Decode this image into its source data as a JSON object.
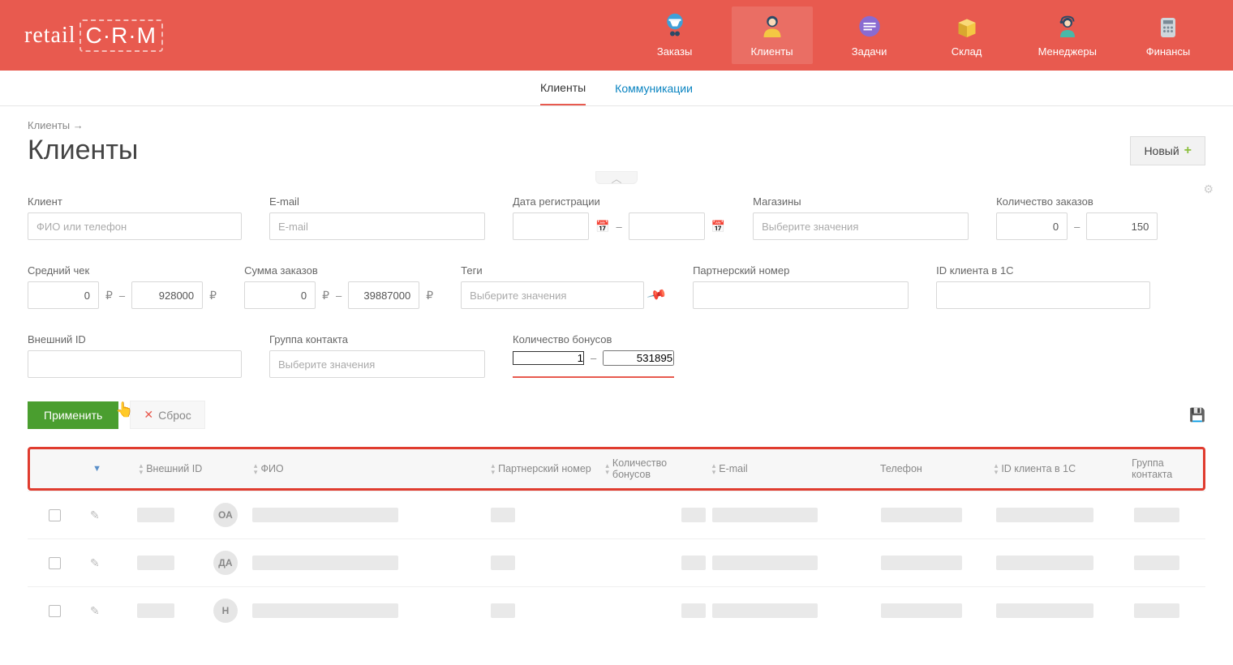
{
  "nav": {
    "logo": "retailCRM",
    "items": [
      {
        "label": "Заказы"
      },
      {
        "label": "Клиенты"
      },
      {
        "label": "Задачи"
      },
      {
        "label": "Склад"
      },
      {
        "label": "Менеджеры"
      },
      {
        "label": "Финансы"
      }
    ]
  },
  "subnav": {
    "clients": "Клиенты",
    "communications": "Коммуникации"
  },
  "breadcrumb": "Клиенты →",
  "page_title": "Клиенты",
  "new_button": "Новый",
  "filters": {
    "client": {
      "label": "Клиент",
      "placeholder": "ФИО или телефон"
    },
    "email": {
      "label": "E-mail",
      "placeholder": "E-mail"
    },
    "reg_date": {
      "label": "Дата регистрации"
    },
    "stores": {
      "label": "Магазины",
      "placeholder": "Выберите значения"
    },
    "order_count": {
      "label": "Количество заказов",
      "from": "0",
      "to": "150"
    },
    "avg_check": {
      "label": "Средний чек",
      "from": "0",
      "to": "928000",
      "unit": "₽"
    },
    "order_sum": {
      "label": "Сумма заказов",
      "from": "0",
      "to": "39887000",
      "unit": "₽"
    },
    "tags": {
      "label": "Теги",
      "placeholder": "Выберите значения"
    },
    "partner_num": {
      "label": "Партнерский номер"
    },
    "id_1c": {
      "label": "ID клиента в 1С"
    },
    "external_id": {
      "label": "Внешний ID"
    },
    "contact_group": {
      "label": "Группа контакта",
      "placeholder": "Выберите значения"
    },
    "bonus_count": {
      "label": "Количество бонусов",
      "from": "1",
      "to": "531895"
    }
  },
  "actions": {
    "apply": "Применить",
    "reset": "Сброс"
  },
  "table": {
    "headers": {
      "external_id": "Внешний ID",
      "fio": "ФИО",
      "partner_num": "Партнерский номер",
      "bonus_count": "Количество бонусов",
      "email": "E-mail",
      "phone": "Телефон",
      "id_1c": "ID клиента в 1С",
      "group": "Группа контакта"
    },
    "rows": [
      {
        "avatar": "ОА"
      },
      {
        "avatar": "ДА"
      },
      {
        "avatar": "Н"
      }
    ]
  }
}
